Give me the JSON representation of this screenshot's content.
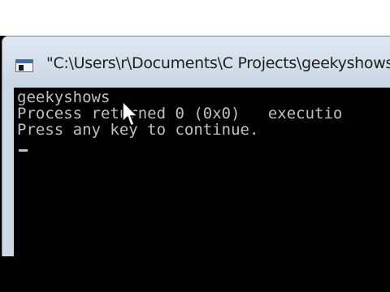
{
  "window": {
    "title": "\"C:\\Users\\r\\Documents\\C Projects\\geekyshowscp"
  },
  "console": {
    "lines": [
      "geekyshows",
      "Process returned 0 (0x0)   executio",
      "Press any key to continue."
    ]
  },
  "icons": {
    "app": "console-window-icon",
    "pointer": "mouse-pointer-icon"
  },
  "colors": {
    "console_background": "#000000",
    "console_text": "#c0c0c0",
    "titlebar": "#cdd9e6"
  }
}
